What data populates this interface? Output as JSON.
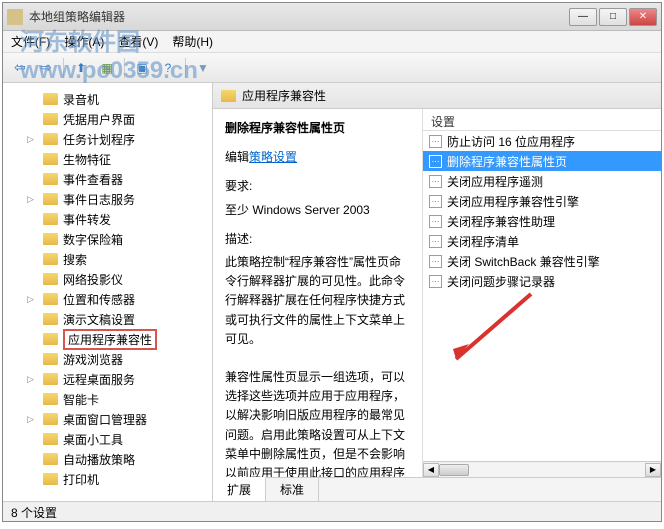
{
  "watermark": "河东软件园\nwww.pc0359.cn",
  "window": {
    "title": "本地组策略编辑器"
  },
  "menu": {
    "file": "文件(F)",
    "action": "操作(A)",
    "view": "查看(V)",
    "help": "帮助(H)"
  },
  "tree": {
    "items": [
      {
        "label": "录音机",
        "arrow": ""
      },
      {
        "label": "凭据用户界面",
        "arrow": ""
      },
      {
        "label": "任务计划程序",
        "arrow": "▷"
      },
      {
        "label": "生物特征",
        "arrow": ""
      },
      {
        "label": "事件查看器",
        "arrow": ""
      },
      {
        "label": "事件日志服务",
        "arrow": "▷"
      },
      {
        "label": "事件转发",
        "arrow": ""
      },
      {
        "label": "数字保险箱",
        "arrow": ""
      },
      {
        "label": "搜索",
        "arrow": ""
      },
      {
        "label": "网络投影仪",
        "arrow": ""
      },
      {
        "label": "位置和传感器",
        "arrow": "▷"
      },
      {
        "label": "演示文稿设置",
        "arrow": ""
      },
      {
        "label": "应用程序兼容性",
        "arrow": "",
        "selected": true
      },
      {
        "label": "游戏浏览器",
        "arrow": ""
      },
      {
        "label": "远程桌面服务",
        "arrow": "▷"
      },
      {
        "label": "智能卡",
        "arrow": ""
      },
      {
        "label": "桌面窗口管理器",
        "arrow": "▷"
      },
      {
        "label": "桌面小工具",
        "arrow": ""
      },
      {
        "label": "自动播放策略",
        "arrow": ""
      },
      {
        "label": "打印机",
        "arrow": ""
      }
    ]
  },
  "right": {
    "header": "应用程序兼容性",
    "detail": {
      "title": "删除程序兼容性属性页",
      "edit_prefix": "编辑",
      "edit_link": "策略设置",
      "req_label": "要求:",
      "req_value": "至少 Windows Server 2003",
      "desc_label": "描述:",
      "desc_body": "此策略控制“程序兼容性”属性页命令行解释器扩展的可见性。此命令行解释器扩展在任何程序快捷方式或可执行文件的属性上下文菜单上可见。\n\n兼容性属性页显示一组选项，可以选择这些选项并应用于应用程序，以解决影响旧版应用程序的最常见问题。启用此策略设置可从上下文菜单中删除属性页，但是不会影响以前应用于使用此接口的应用程序的兼容性设置。"
    },
    "settings_header": "设置",
    "settings": [
      {
        "label": "防止访问 16 位应用程序"
      },
      {
        "label": "删除程序兼容性属性页",
        "selected": true
      },
      {
        "label": "关闭应用程序遥测"
      },
      {
        "label": "关闭应用程序兼容性引擎"
      },
      {
        "label": "关闭程序兼容性助理"
      },
      {
        "label": "关闭程序清单"
      },
      {
        "label": "关闭 SwitchBack 兼容性引擎"
      },
      {
        "label": "关闭问题步骤记录器"
      }
    ],
    "tabs": {
      "extended": "扩展",
      "standard": "标准"
    }
  },
  "status": "8 个设置"
}
